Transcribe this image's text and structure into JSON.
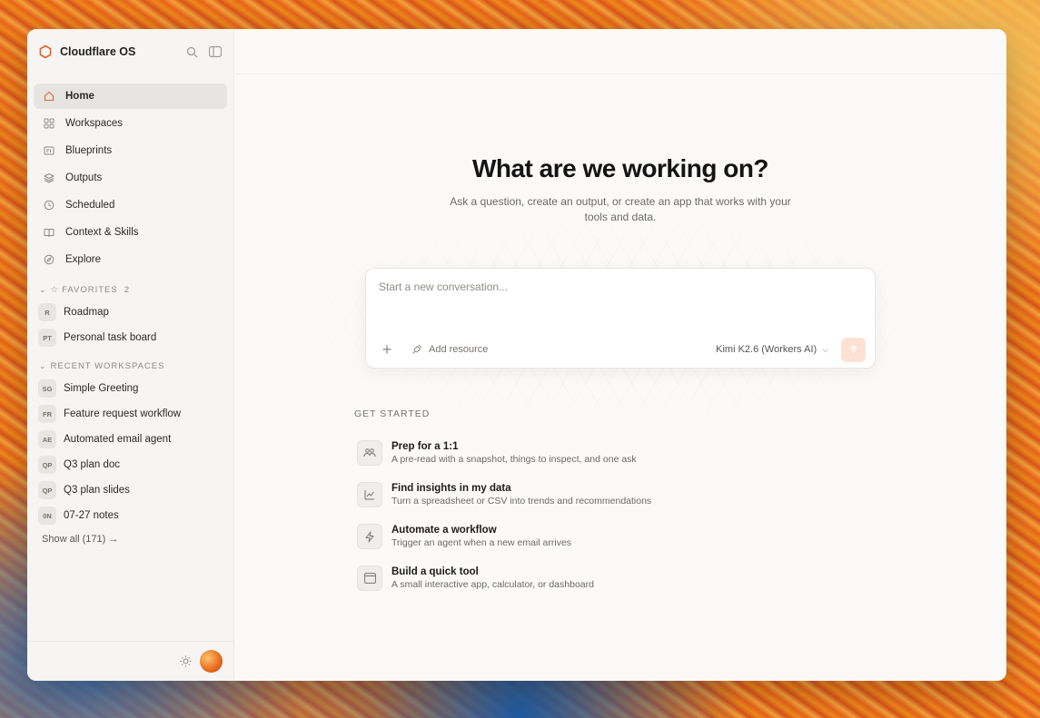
{
  "app": {
    "name": "Cloudflare OS",
    "accent": "#e0662a"
  },
  "sidebar": {
    "nav": [
      {
        "label": "Home",
        "icon": "home-icon",
        "active": true
      },
      {
        "label": "Workspaces",
        "icon": "grid-icon"
      },
      {
        "label": "Blueprints",
        "icon": "blueprint-icon"
      },
      {
        "label": "Outputs",
        "icon": "layers-icon"
      },
      {
        "label": "Scheduled",
        "icon": "clock-icon"
      },
      {
        "label": "Context & Skills",
        "icon": "book-icon"
      },
      {
        "label": "Explore",
        "icon": "compass-icon"
      }
    ],
    "favorites": {
      "title": "FAVORITES",
      "count": "2",
      "items": [
        {
          "badge": "R",
          "label": "Roadmap"
        },
        {
          "badge": "PT",
          "label": "Personal task board"
        }
      ]
    },
    "recent": {
      "title": "RECENT WORKSPACES",
      "items": [
        {
          "badge": "SG",
          "label": "Simple Greeting"
        },
        {
          "badge": "FR",
          "label": "Feature request workflow"
        },
        {
          "badge": "AE",
          "label": "Automated email agent"
        },
        {
          "badge": "QP",
          "label": "Q3 plan doc"
        },
        {
          "badge": "QP",
          "label": "Q3 plan slides"
        },
        {
          "badge": "0N",
          "label": "07-27 notes"
        }
      ]
    },
    "show_all": "Show all (171) →"
  },
  "main": {
    "heading": "What are we working on?",
    "subheading": "Ask a question, create an output, or create an app that works with your tools and data.",
    "composer": {
      "placeholder": "Start a new conversation...",
      "add_resource": "Add resource",
      "model": "Kimi K2.6 (Workers AI)"
    },
    "get_started": {
      "title": "GET STARTED",
      "items": [
        {
          "title": "Prep for a 1:1",
          "desc": "A pre-read with a snapshot, things to inspect, and one ask",
          "icon": "people-icon"
        },
        {
          "title": "Find insights in my data",
          "desc": "Turn a spreadsheet or CSV into trends and recommendations",
          "icon": "chart-icon"
        },
        {
          "title": "Automate a workflow",
          "desc": "Trigger an agent when a new email arrives",
          "icon": "bolt-icon"
        },
        {
          "title": "Build a quick tool",
          "desc": "A small interactive app, calculator, or dashboard",
          "icon": "app-window-icon"
        }
      ]
    }
  }
}
